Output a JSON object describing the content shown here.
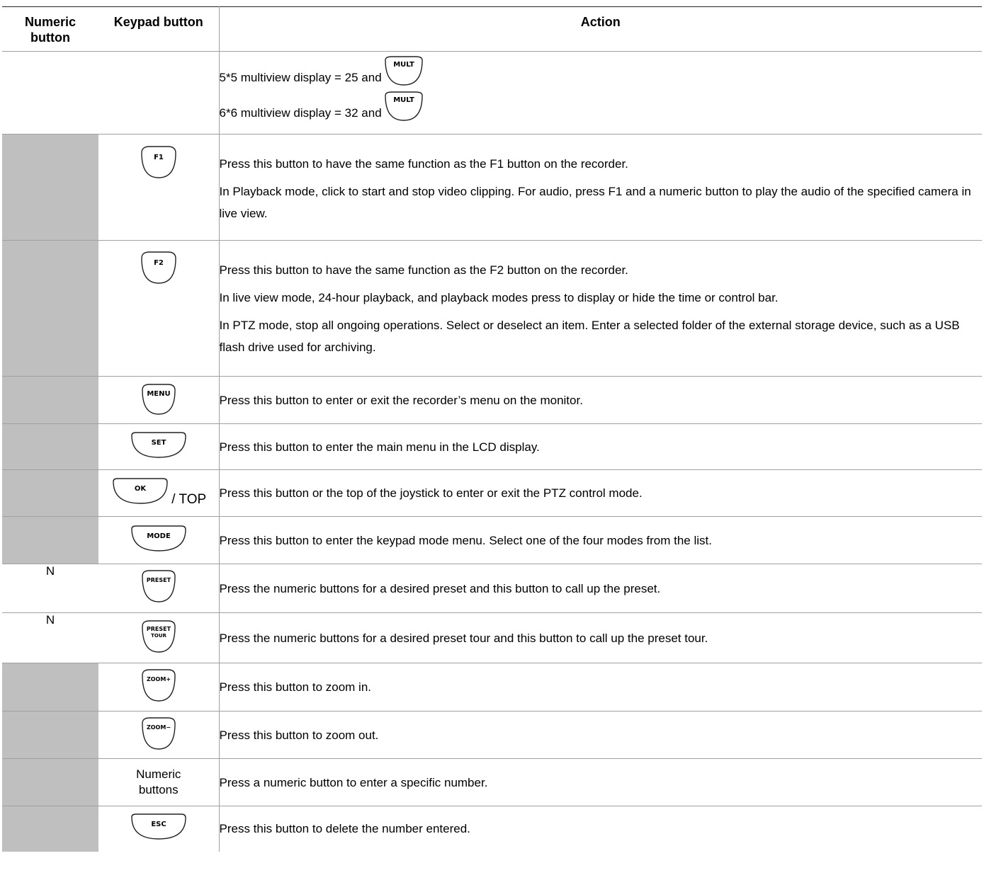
{
  "table": {
    "headers": {
      "numeric": "Numeric button",
      "keypad": "Keypad button",
      "action": "Action"
    },
    "multiview": {
      "line1": "5*5  multiview display = 25 and",
      "line2": "6*6  multiview display = 32 and",
      "button": "MULT"
    },
    "rows": [
      {
        "numeric": "",
        "key": "F1",
        "key_icon": "f1-button-icon",
        "actions": [
          "Press this button to have the same function as the F1 button on the recorder.",
          "In Playback mode, click to start and stop video clipping. For audio, press F1 and a numeric button to play the audio of the specified camera in live view."
        ]
      },
      {
        "numeric": "",
        "key": "F2",
        "key_icon": "f2-button-icon",
        "actions": [
          "Press this button to have the same function as the F2 button on the recorder.",
          "In live view mode, 24-hour playback, and playback modes press to display or hide the time or control bar.",
          "In PTZ mode, stop all ongoing operations. Select or deselect an item. Enter a selected folder of the external storage device, such as a USB flash drive used for archiving."
        ]
      },
      {
        "numeric": "",
        "key": "MENU",
        "key_icon": "menu-button-icon",
        "actions": [
          "Press this button to enter or exit the recorder’s menu on the monitor."
        ]
      },
      {
        "numeric": "",
        "key": "SET",
        "key_icon": "set-button-icon",
        "actions": [
          "Press this button to enter the main menu in the LCD display."
        ]
      },
      {
        "numeric": "",
        "key": "OK",
        "key_suffix": "/ TOP",
        "key_icon": "ok-button-icon",
        "actions": [
          "Press this button or the top of the joystick to enter or exit the PTZ control mode."
        ]
      },
      {
        "numeric": "",
        "key": "MODE",
        "key_icon": "mode-button-icon",
        "actions": [
          "Press this button to enter the keypad mode menu. Select one of the four modes from the list."
        ]
      },
      {
        "numeric": "N",
        "key": "PRESET",
        "key_icon": "preset-button-icon",
        "actions": [
          "Press the numeric buttons for a desired preset and this button to call up the preset."
        ]
      },
      {
        "numeric": "N",
        "key": "PRESET",
        "key_sub": "TOUR",
        "key_icon": "preset-tour-button-icon",
        "actions": [
          "Press the numeric buttons for a desired preset tour and this button to call up the preset tour."
        ]
      },
      {
        "numeric": "",
        "key": "ZOOM+",
        "key_icon": "zoom-in-button-icon",
        "actions": [
          "Press this button to zoom in."
        ]
      },
      {
        "numeric": "",
        "key": "ZOOM−",
        "key_icon": "zoom-out-button-icon",
        "actions": [
          "Press this button to zoom out."
        ]
      },
      {
        "numeric": "",
        "key_text": "Numeric buttons",
        "actions": [
          "Press a numeric button to enter a specific number."
        ]
      },
      {
        "numeric": "",
        "key": "ESC",
        "key_icon": "esc-button-icon",
        "actions": [
          "Press this button to delete the number entered."
        ]
      }
    ]
  }
}
